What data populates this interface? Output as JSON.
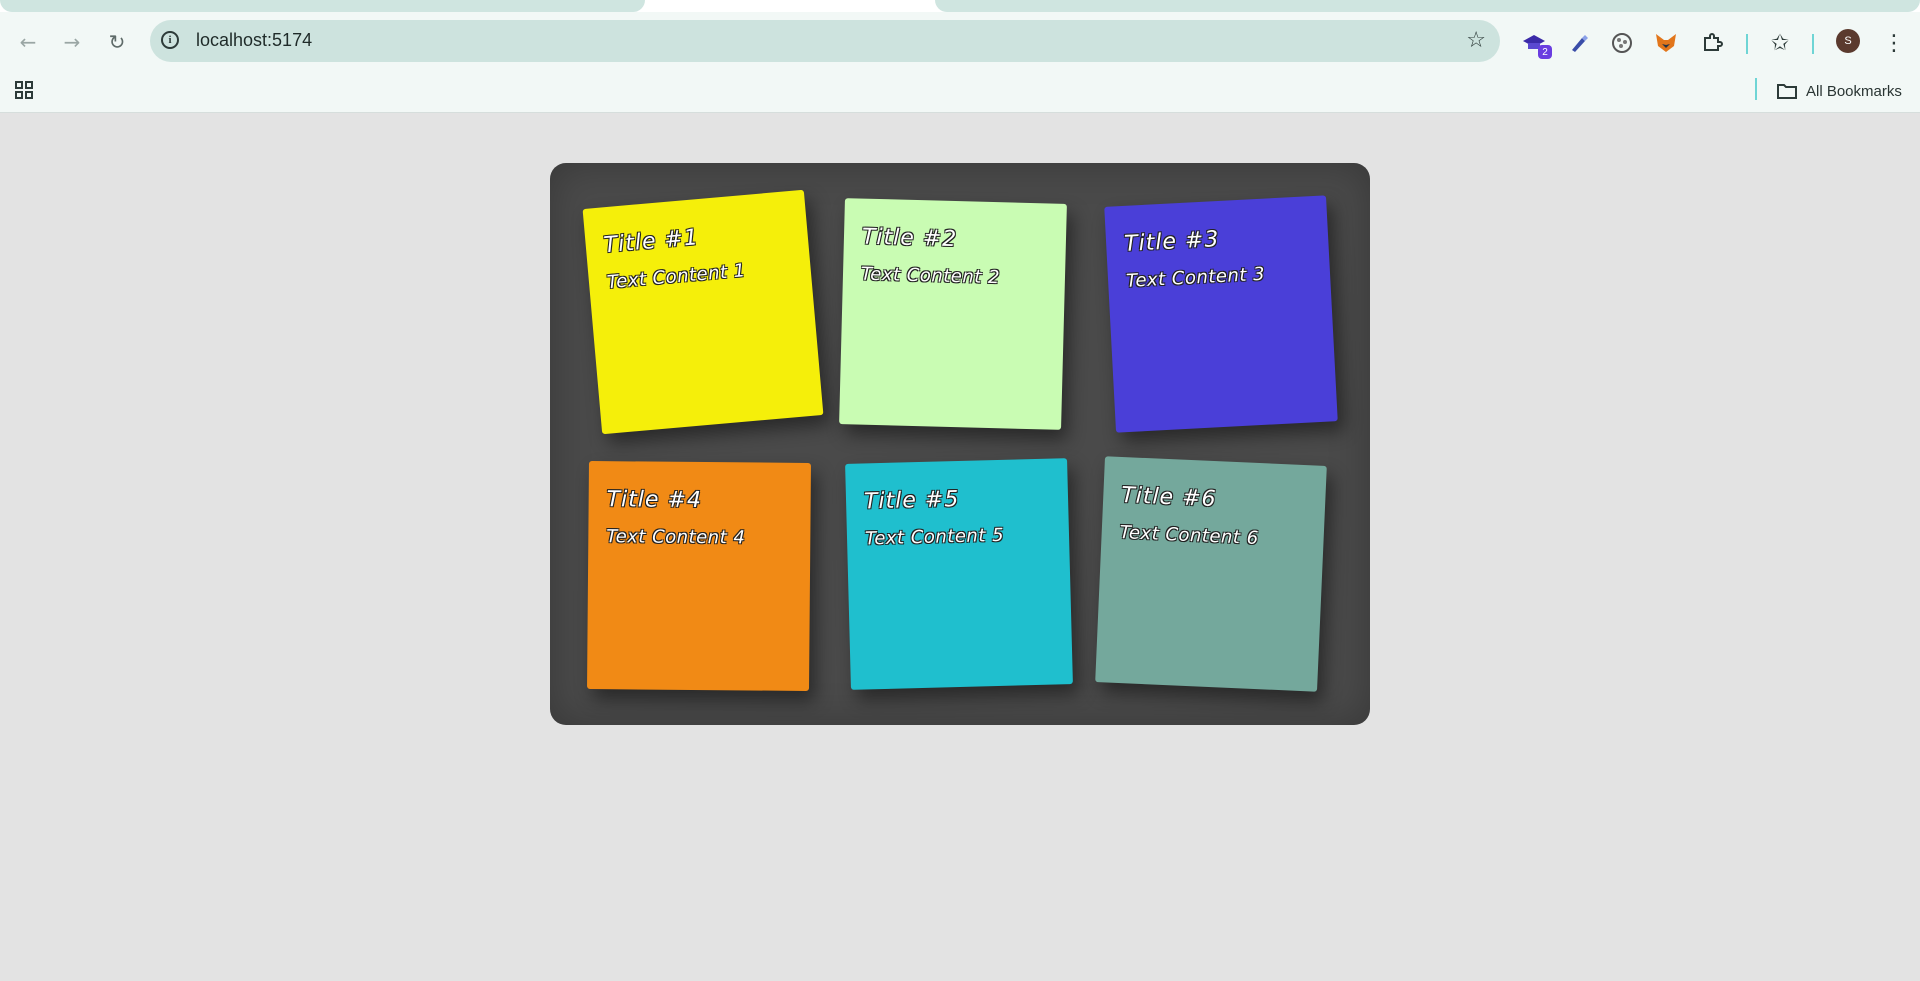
{
  "browser": {
    "url": "localhost:5174",
    "extensions": [
      {
        "name": "extension-graduation-cap-icon",
        "badge": "2"
      },
      {
        "name": "extension-pen-icon",
        "badge": ""
      },
      {
        "name": "extension-globe-icon",
        "badge": ""
      },
      {
        "name": "extension-fox-icon",
        "badge": ""
      },
      {
        "name": "extensions-puzzle-icon",
        "badge": ""
      }
    ],
    "profile_initial": "S",
    "bookmarks_folder_label": "All Bookmarks"
  },
  "board": {
    "background_color": "#4a4a4a",
    "notes": [
      {
        "title": "Title #1",
        "content": "Text Content 1",
        "color": "#f5ef0a"
      },
      {
        "title": "Title #2",
        "content": "Text Content 2",
        "color": "#c9fcb3"
      },
      {
        "title": "Title #3",
        "content": "Text Content 3",
        "color": "#4a3fd8"
      },
      {
        "title": "Title #4",
        "content": "Text Content 4",
        "color": "#f18a15"
      },
      {
        "title": "Title #5",
        "content": "Text Content 5",
        "color": "#1fbfce"
      },
      {
        "title": "Title #6",
        "content": "Text Content 6",
        "color": "#74a89c"
      }
    ]
  }
}
